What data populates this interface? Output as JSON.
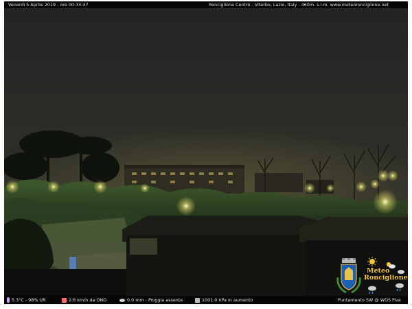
{
  "header": {
    "datetime": "Venerdì 5 Aprile 2019 - ore 00:33:37",
    "location": "Ronciglione Centro - Viterbo, Lazio, Italy - 460m. s.l.m.    www.meteoronciglione.net"
  },
  "footer": {
    "temperature_humidity": "5.3°C - 98% UR",
    "wind": "2.6 km/h da ONO",
    "rain": "0.0 mm - Pioggia assente",
    "pressure": "1001.0 hPa in aumento",
    "camera": "Puntamento SW  @ WDS Five"
  },
  "logo": {
    "line1": "Meteo",
    "line2": "Ronciglione"
  },
  "colors": {
    "sky": "#2b2b27",
    "lamp_glow": "#e7e06a",
    "logo_text": "#f2c531"
  }
}
